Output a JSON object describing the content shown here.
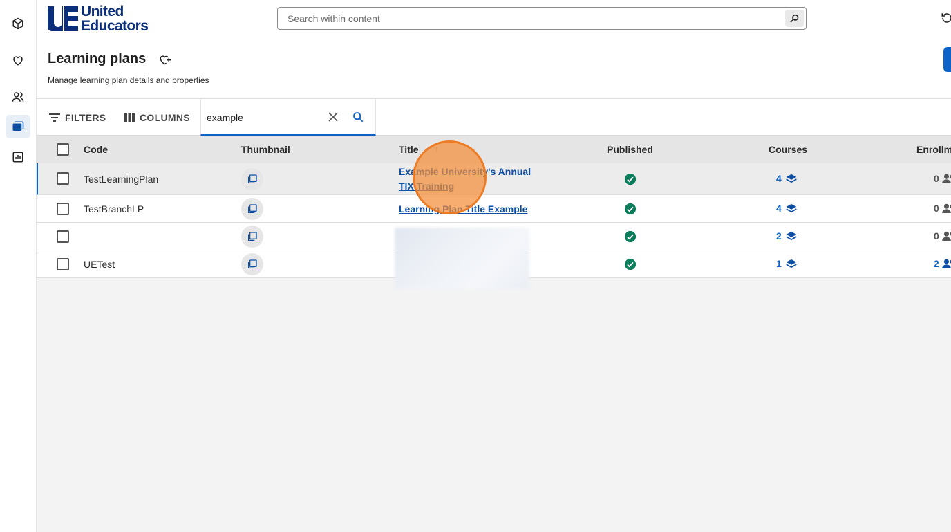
{
  "brand": {
    "line1": "United",
    "line2": "Educators",
    "mark": "UE"
  },
  "search": {
    "placeholder": "Search within content"
  },
  "page": {
    "title": "Learning plans",
    "subtitle": "Manage learning plan details and properties"
  },
  "rail": [
    "cube-icon",
    "heart-icon",
    "people-icon",
    "folders-icon",
    "chart-icon"
  ],
  "toolbar": {
    "filters_label": "FILTERS",
    "columns_label": "COLUMNS",
    "filter_value": "example"
  },
  "table": {
    "headers": {
      "code": "Code",
      "thumbnail": "Thumbnail",
      "title": "Title",
      "published": "Published",
      "courses": "Courses",
      "enrollments": "Enrollm"
    },
    "sort": {
      "column": "Title",
      "direction": "ascending"
    },
    "rows": [
      {
        "code": "TestLearningPlan",
        "title_line1": "Example University's Annual",
        "title_line2": "TIX Training",
        "published": true,
        "courses": "4",
        "enrollments": "0"
      },
      {
        "code": "TestBranchLP",
        "title_line1": "Learning Plan Title Example",
        "title_line2": "",
        "published": true,
        "courses": "4",
        "enrollments": "0"
      },
      {
        "code": "",
        "title_line1": "",
        "title_line2": "",
        "published": true,
        "courses": "2",
        "enrollments": "0"
      },
      {
        "code": "UETest",
        "title_line1": "",
        "title_line2": "",
        "published": true,
        "courses": "1",
        "enrollments": "2"
      }
    ]
  },
  "colors": {
    "brand_navy": "#0b2f7a",
    "accent_blue": "#0d63c7",
    "published_green": "#0a7d5a",
    "click_marker": "#f38d38"
  }
}
